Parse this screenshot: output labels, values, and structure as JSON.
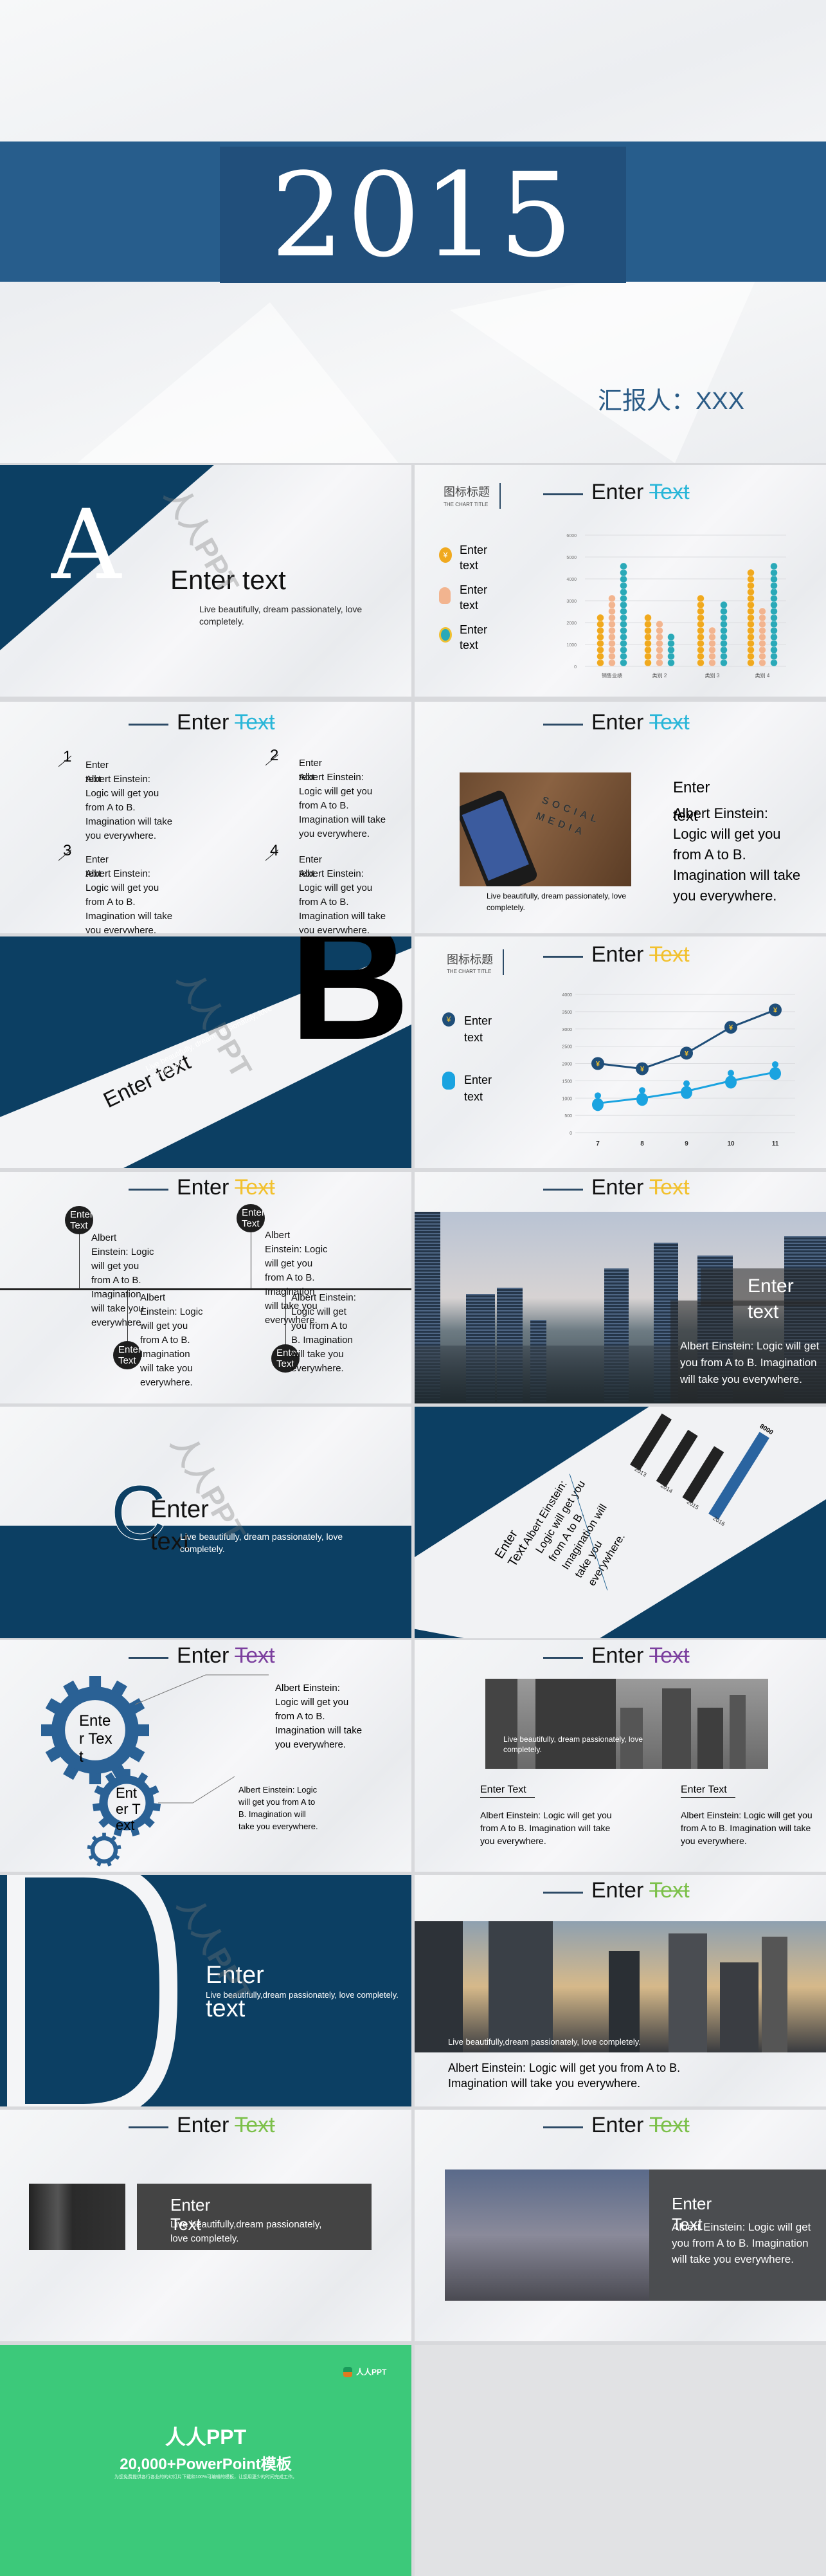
{
  "cover": {
    "year": "2015",
    "reporter": "汇报人：XXX",
    "color_band": "#275d8c",
    "color_box": "#214f7b"
  },
  "watermark": "人人PPT",
  "accent": {
    "cyan": "#29b6d8",
    "yellow": "#f2c12e",
    "purple": "#7b3f9e",
    "green": "#7cc04a",
    "navy": "#0c3f63"
  },
  "header": {
    "enter": "Enter",
    "text": "Text"
  },
  "s1": {
    "letter": "A",
    "title": "Enter text",
    "sub": "Live beautifully, dream passionately, love completely."
  },
  "s2": {
    "chart_title_cn": "图标标题",
    "chart_title_en": "THE CHART TITLE",
    "legend": [
      "Enter text",
      "Enter text",
      "Enter text"
    ]
  },
  "s3": {
    "items": [
      {
        "num": "1",
        "label": "Enter text",
        "body": "Albert Einstein: Logic will get you from A to B. Imagination will take you everywhere."
      },
      {
        "num": "2",
        "label": "Enter text",
        "body": "Albert Einstein: Logic will get you from A to B. Imagination will take you everywhere."
      },
      {
        "num": "3",
        "label": "Enter text",
        "body": "Albert Einstein: Logic will get you from A to B. Imagination will take you everywhere."
      },
      {
        "num": "4",
        "label": "Enter text",
        "body": "Albert Einstein: Logic will get you from A to B. Imagination will take you everywhere."
      }
    ]
  },
  "s4": {
    "caption": "Live beautifully, dream passionately, love completely.",
    "label": "Enter text",
    "body": "Albert Einstein: Logic will get you from A to B. Imagination will take you everywhere.",
    "photo_words": "SOCIAL MEDIA"
  },
  "s5": {
    "letter": "B",
    "title": "Enter text",
    "sub": "Live beautifully, dream passionately, love completely."
  },
  "s6": {
    "chart_title_cn": "图标标题",
    "chart_title_en": "THE CHART TITLE",
    "legend": [
      "Enter text",
      "Enter text"
    ]
  },
  "s7": {
    "items": [
      {
        "circle": "Enter Text",
        "body": "Albert Einstein: Logic will get you from A to B. Imagination will take you everywhere."
      },
      {
        "circle": "Enter Text",
        "body": "Albert Einstein: Logic will get you from A to B. Imagination will take you everywhere."
      },
      {
        "circle": "Enter Text",
        "body": "Albert Einstein: Logic will get you from A to B. Imagination will take you everywhere."
      },
      {
        "circle": "Enter Text",
        "body": "Albert Einstein: Logic will get you from A to B. Imagination will take you everywhere."
      }
    ]
  },
  "s8": {
    "label": "Enter text",
    "body": "Albert Einstein: Logic will get you from A to B. Imagination will take you everywhere."
  },
  "s9": {
    "letter": "C",
    "title": "Enter text",
    "sub": "Live beautifully, dream passionately, love completely."
  },
  "s10": {
    "label": "Enter Text",
    "body": "Albert Einstein: Logic will get you from A to B. Imagination will take you everywhere."
  },
  "s11": {
    "gears": [
      "Enter Text",
      "Enter Text"
    ],
    "bodies": [
      "Albert Einstein: Logic will get you from A to B. Imagination will take you everywhere.",
      "Albert Einstein: Logic will get you from A to B. Imagination will take you everywhere."
    ]
  },
  "s12": {
    "caption": "Live beautifully, dream passionately, love completely.",
    "cols": [
      {
        "label": "Enter Text",
        "body": "Albert Einstein: Logic will get you from A to B. Imagination will take you everywhere."
      },
      {
        "label": "Enter Text",
        "body": "Albert Einstein: Logic will get you from A to B. Imagination will take you everywhere."
      }
    ]
  },
  "s13": {
    "letter": "D",
    "title": "Enter text",
    "sub": "Live beautifully,dream passionately, love completely."
  },
  "s14": {
    "caption": "Live beautifully,dream passionately, love completely.",
    "body": "Albert Einstein: Logic will get you from A to B. Imagination will take you everywhere."
  },
  "s15": {
    "label": "Enter Text",
    "sub": "Live beautifully,dream passionately, love completely."
  },
  "s16": {
    "label": "Enter Text",
    "body": "Albert Einstein: Logic will get you from A to B. Imagination will take you everywhere."
  },
  "end": {
    "logo": "人人PPT",
    "title": "人人PPT",
    "subtitle": "20,000+PowerPoint模板",
    "desc": "为您免费提供各行各业的的幻灯片下载和100%可编辑的模板，让您用更少的时间完成工作。",
    "color": "#3cc97a"
  },
  "chart_data": [
    {
      "type": "bar",
      "categories": [
        "销售业绩",
        "类别 2",
        "类别 3",
        "类别 4"
      ],
      "series": [
        {
          "name": "Enter text",
          "values": [
            2400,
            2600,
            3500,
            4500
          ],
          "color": "#f0a91e",
          "icon": "yuan-coin-icon"
        },
        {
          "name": "Enter text",
          "values": [
            3500,
            2300,
            1800,
            2800
          ],
          "color": "#f2b48f",
          "icon": "person-icon"
        },
        {
          "name": "Enter text",
          "values": [
            4800,
            1500,
            3000,
            5000
          ],
          "color": "#2aa9b8",
          "icon": "medal-icon"
        }
      ],
      "ylim": [
        0,
        6000
      ],
      "yticks": [
        0,
        1000,
        2000,
        3000,
        4000,
        5000,
        6000
      ],
      "grid": true,
      "legend": "left"
    },
    {
      "type": "line",
      "x": [
        7,
        8,
        9,
        10,
        11
      ],
      "series": [
        {
          "name": "Enter text",
          "values": [
            2000,
            1850,
            2300,
            3050,
            3550
          ],
          "color": "#1f4e79",
          "icon": "yuan-coin-icon"
        },
        {
          "name": "Enter text",
          "values": [
            850,
            1000,
            1200,
            1500,
            1750
          ],
          "color": "#1aa3e0",
          "icon": "person-icon"
        }
      ],
      "ylim": [
        0,
        4000
      ],
      "yticks": [
        0,
        500,
        1000,
        1500,
        2000,
        2500,
        3000,
        3500,
        4000
      ],
      "grid": true,
      "legend": "left"
    },
    {
      "type": "bar",
      "orientation": "rotated",
      "categories": [
        "2013",
        "2014",
        "2015",
        "2016"
      ],
      "values": [
        5000,
        5000,
        5000,
        8000
      ],
      "data_labels": {
        "2016": "8000"
      },
      "colors": [
        "#222222",
        "#222222",
        "#222222",
        "#2a64a0"
      ]
    }
  ]
}
